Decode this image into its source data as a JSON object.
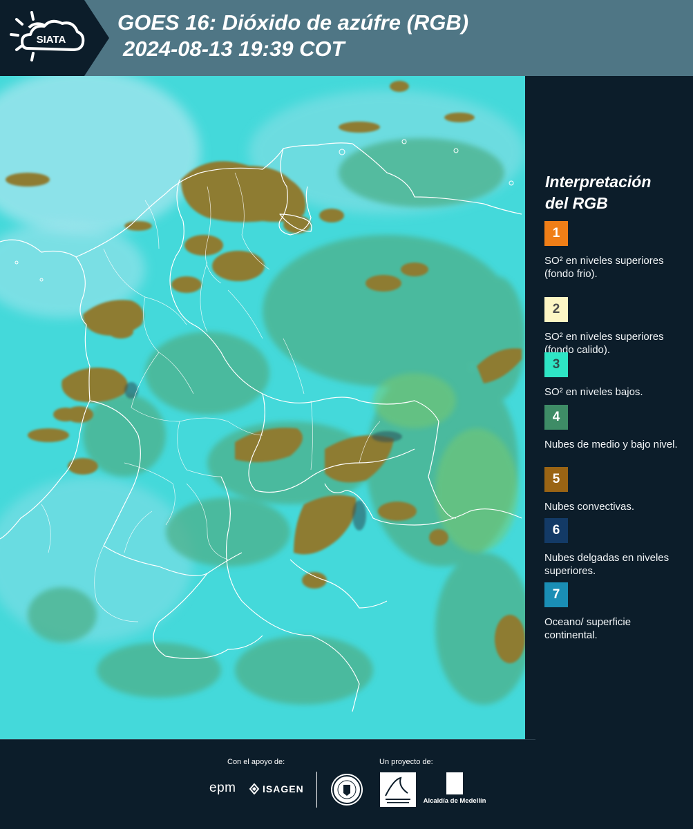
{
  "header": {
    "logo_text": "SIATA",
    "title_line1": "GOES 16: Dióxido de azúfre (RGB)",
    "title_line2": "2024-08-13 19:39 COT"
  },
  "legend": {
    "title_line1": "Interpretación",
    "title_line2": "del RGB",
    "items": [
      {
        "number": "1",
        "color": "#f07e17",
        "text_color": "#ffffff",
        "description": "SO² en niveles superiores (fondo frio)."
      },
      {
        "number": "2",
        "color": "#fdf6c4",
        "text_color": "#4d4d4d",
        "description": "SO² en niveles superiores (fondo calido)."
      },
      {
        "number": "3",
        "color": "#2ee5c5",
        "text_color": "#2f4f4f",
        "description": "SO² en niveles bajos."
      },
      {
        "number": "4",
        "color": "#3e8c66",
        "text_color": "#ffffff",
        "description": "Nubes de medio y bajo nivel."
      },
      {
        "number": "5",
        "color": "#9a6414",
        "text_color": "#ffffff",
        "description": "Nubes convectivas."
      },
      {
        "number": "6",
        "color": "#133a66",
        "text_color": "#ffffff",
        "description": "Nubes delgadas en niveles superiores."
      },
      {
        "number": "7",
        "color": "#1a8eb5",
        "text_color": "#ffffff",
        "description": "Oceano/ superficie continental."
      }
    ]
  },
  "footer": {
    "support_label": "Con el apoyo de:",
    "project_label": "Un proyecto de:",
    "sponsor_1": "epm",
    "sponsor_2": "ISAGEN",
    "partner_3": "Alcaldía de Medellín"
  },
  "colors": {
    "background": "#0c1d2a",
    "header": "#4f7685",
    "map_base": "#3fd6d8",
    "cloud_convective": "#8f7a2e",
    "cloud_mid": "#4fae8a"
  },
  "icons": [
    "siata-logo-icon",
    "sun-icon",
    "cloud-icon"
  ]
}
